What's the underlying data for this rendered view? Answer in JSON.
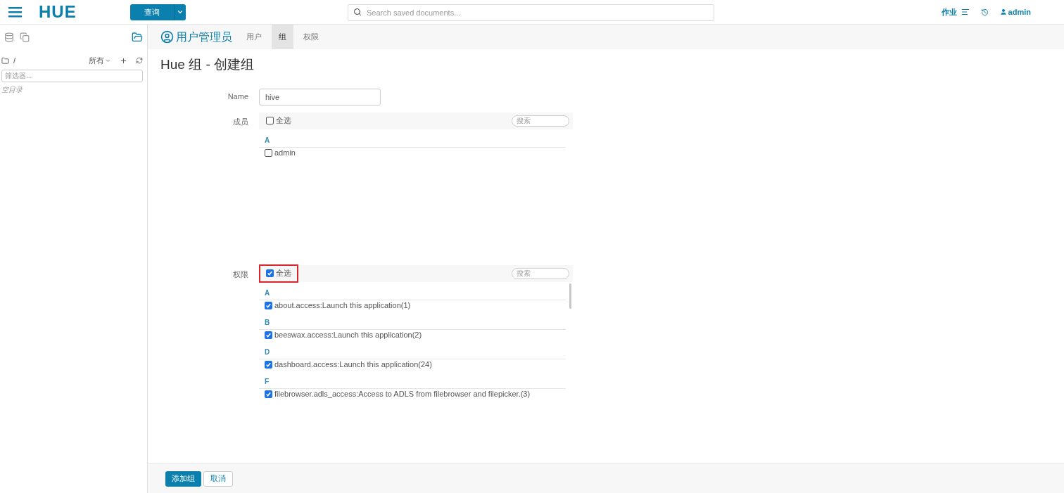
{
  "topbar": {
    "logo": "HUE",
    "query_button": "查询",
    "search": {
      "placeholder": "Search saved documents..."
    },
    "jobs": "作业",
    "user": "admin"
  },
  "sidebar": {
    "path": "/",
    "filter_menu": "所有",
    "filter": {
      "placeholder": "筛选器..."
    },
    "empty": "空目录"
  },
  "app": {
    "title": "用户管理员",
    "tabs": [
      {
        "label": "用户",
        "selected": false
      },
      {
        "label": "组",
        "selected": true
      },
      {
        "label": "权限",
        "selected": false
      }
    ]
  },
  "page_title": "Hue 组 - 创建组",
  "form": {
    "name_label": "Name",
    "name_value": "hive",
    "members": {
      "label": "成员",
      "select_all": {
        "label": "全选",
        "checked": false,
        "highlighted": false
      },
      "search": {
        "placeholder": "搜索"
      },
      "groups": [
        {
          "letter": "A",
          "items": [
            {
              "label": "admin",
              "checked": false
            }
          ]
        }
      ]
    },
    "permissions": {
      "label": "权限",
      "select_all": {
        "label": "全选",
        "checked": true,
        "highlighted": true
      },
      "search": {
        "placeholder": "搜索"
      },
      "groups": [
        {
          "letter": "A",
          "items": [
            {
              "label": "about.access:Launch this application(1)",
              "checked": true
            }
          ]
        },
        {
          "letter": "B",
          "items": [
            {
              "label": "beeswax.access:Launch this application(2)",
              "checked": true
            }
          ]
        },
        {
          "letter": "D",
          "items": [
            {
              "label": "dashboard.access:Launch this application(24)",
              "checked": true
            }
          ]
        },
        {
          "letter": "F",
          "items": [
            {
              "label": "filebrowser.adls_access:Access to ADLS from filebrowser and filepicker.(3)",
              "checked": true
            }
          ]
        }
      ]
    }
  },
  "footer": {
    "buttons": [
      {
        "label": "添加组",
        "kind": "primary"
      },
      {
        "label": "取消",
        "kind": "secondary"
      }
    ]
  }
}
